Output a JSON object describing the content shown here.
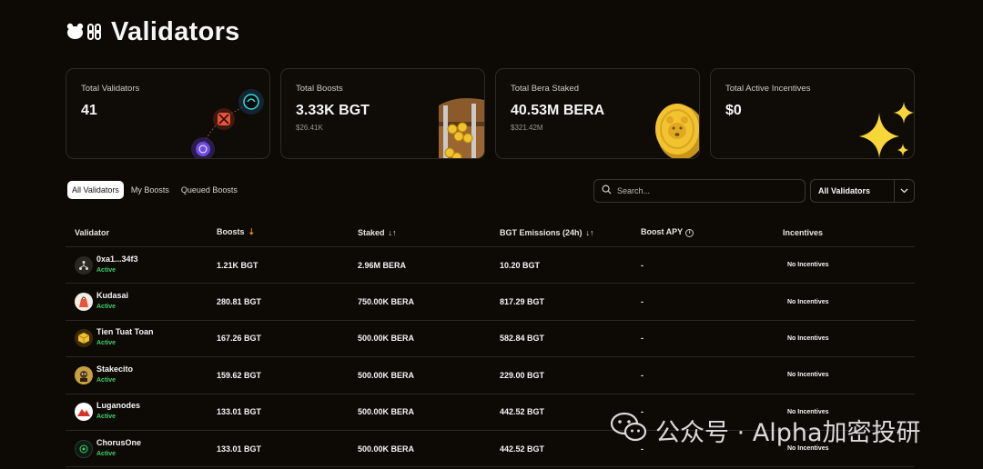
{
  "page": {
    "title": "Validators"
  },
  "stats": [
    {
      "label": "Total Validators",
      "value": "41",
      "sub": ""
    },
    {
      "label": "Total Boosts",
      "value": "3.33K BGT",
      "sub": "$26.41K"
    },
    {
      "label": "Total Bera Staked",
      "value": "40.53M BERA",
      "sub": "$321.42M"
    },
    {
      "label": "Total Active Incentives",
      "value": "$0",
      "sub": ""
    }
  ],
  "tabs": [
    "All Validators",
    "My Boosts",
    "Queued Boosts"
  ],
  "search": {
    "placeholder": "Search..."
  },
  "filter": {
    "selected": "All Validators"
  },
  "table": {
    "headers": [
      "Validator",
      "Boosts",
      "Staked",
      "BGT Emissions (24h)",
      "Boost APY",
      "Incentives"
    ],
    "rows": [
      {
        "name": "0xa1...34f3",
        "status": "Active",
        "boosts": "1.21K BGT",
        "staked": "2.96M BERA",
        "emissions": "10.20 BGT",
        "apy": "-",
        "incentives": "No Incentives"
      },
      {
        "name": "Kudasai",
        "status": "Active",
        "boosts": "280.81 BGT",
        "staked": "750.00K BERA",
        "emissions": "817.29 BGT",
        "apy": "-",
        "incentives": "No Incentives"
      },
      {
        "name": "Tien Tuat Toan",
        "status": "Active",
        "boosts": "167.26 BGT",
        "staked": "500.00K BERA",
        "emissions": "582.84 BGT",
        "apy": "-",
        "incentives": "No Incentives"
      },
      {
        "name": "Stakecito",
        "status": "Active",
        "boosts": "159.62 BGT",
        "staked": "500.00K BERA",
        "emissions": "229.00 BGT",
        "apy": "-",
        "incentives": "No Incentives"
      },
      {
        "name": "Luganodes",
        "status": "Active",
        "boosts": "133.01 BGT",
        "staked": "500.00K BERA",
        "emissions": "442.52 BGT",
        "apy": "-",
        "incentives": "No Incentives"
      },
      {
        "name": "ChorusOne",
        "status": "Active",
        "boosts": "133.01 BGT",
        "staked": "500.00K BERA",
        "emissions": "442.52 BGT",
        "apy": "-",
        "incentives": "No Incentives"
      }
    ]
  },
  "watermark": {
    "text": "公众号 · Alpha加密投研"
  },
  "colors": {
    "background": "#0d0a06",
    "active": "#3ecf6b",
    "accent": "#f59e0b"
  }
}
